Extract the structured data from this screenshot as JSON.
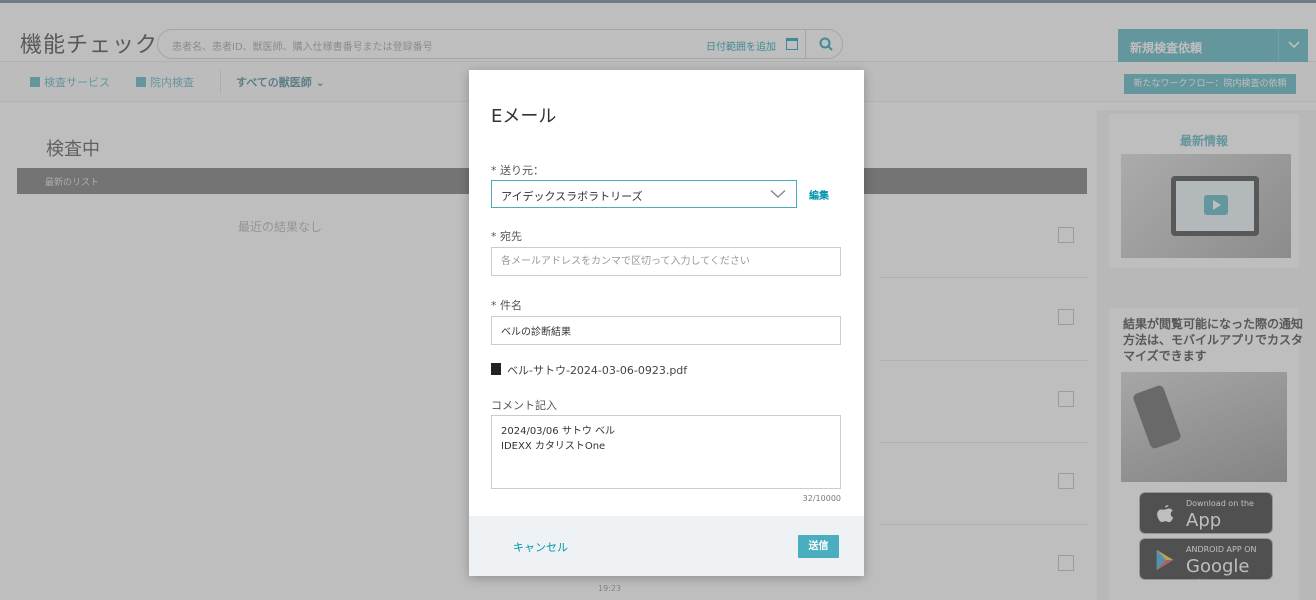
{
  "header": {
    "app_title": "機能チェック",
    "search_placeholder": "患者名、患者ID、獣医師、購入仕様書番号または登録番号",
    "date_range_label": "日付範囲を追加",
    "new_order_label": "新規検査依頼"
  },
  "subnav": {
    "items": [
      {
        "label": "検査サービス",
        "icon": "flask-icon"
      },
      {
        "label": "院内検査",
        "icon": "monitor-icon"
      }
    ],
    "vets_filter": "すべての獣医師",
    "workflow_button": "新たなワークフロー：院内検査の依頼"
  },
  "main": {
    "section_title": "検査中",
    "list_header": "最新のリスト",
    "empty_message": "最近の結果なし",
    "peek_time": "19:23"
  },
  "right_panel": {
    "news_title": "最新情報",
    "promo_text": "結果が閲覧可能になった際の通知方法は、モバイルアプリでカスタマイズできます",
    "app_store": {
      "small": "Download on the",
      "big": "App Store"
    },
    "google_play": {
      "small": "ANDROID APP ON",
      "big": "Google play"
    }
  },
  "modal": {
    "title": "Eメール",
    "from_label": "* 送り元：",
    "from_value": "アイデックスラボラトリーズ",
    "edit_label": "編集",
    "to_label": "* 宛先",
    "to_placeholder": "各メールアドレスをカンマで区切って入力してください",
    "subject_label": "* 件名",
    "subject_value": "ベルの診断結果",
    "attachment": "ベル-サトウ-2024-03-06-0923.pdf",
    "comment_label": "コメント記入",
    "comment_value": "2024/03/06 サトウ ベル\nIDEXX カタリストOne",
    "char_count": "32/10000",
    "cancel_label": "キャンセル",
    "send_label": "送信"
  },
  "colors": {
    "accent": "#4aaebe",
    "link": "#0096ad",
    "overlay": "rgba(125,125,125,0.5)"
  }
}
